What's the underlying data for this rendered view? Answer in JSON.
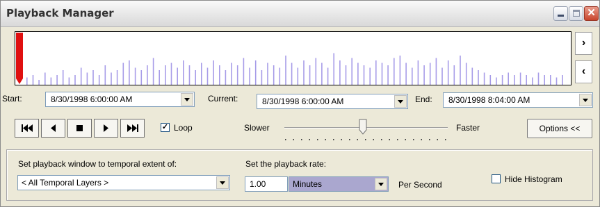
{
  "window": {
    "title": "Playback Manager"
  },
  "title_buttons": {
    "close": "✕"
  },
  "histogram": {
    "scroll_right": "›",
    "scroll_left": "‹",
    "bar_color": "#A79CE8",
    "marker_color": "#E01010",
    "relative_heights": [
      0.15,
      0.2,
      0.1,
      0.25,
      0.15,
      0.2,
      0.3,
      0.15,
      0.2,
      0.35,
      0.25,
      0.3,
      0.2,
      0.4,
      0.25,
      0.3,
      0.45,
      0.5,
      0.35,
      0.3,
      0.4,
      0.55,
      0.3,
      0.4,
      0.45,
      0.35,
      0.5,
      0.4,
      0.3,
      0.45,
      0.35,
      0.5,
      0.4,
      0.3,
      0.45,
      0.4,
      0.55,
      0.35,
      0.5,
      0.3,
      0.45,
      0.4,
      0.35,
      0.6,
      0.45,
      0.35,
      0.5,
      0.4,
      0.55,
      0.45,
      0.35,
      0.65,
      0.5,
      0.4,
      0.55,
      0.45,
      0.4,
      0.35,
      0.5,
      0.45,
      0.4,
      0.55,
      0.6,
      0.45,
      0.35,
      0.5,
      0.4,
      0.45,
      0.55,
      0.35,
      0.5,
      0.4,
      0.6,
      0.45,
      0.35,
      0.3,
      0.25,
      0.2,
      0.15,
      0.2,
      0.25,
      0.2,
      0.25,
      0.2,
      0.15,
      0.25,
      0.2,
      0.2,
      0.15,
      0.2
    ]
  },
  "time_range": {
    "start_label": "Start:",
    "start_value": "8/30/1998  6:00:00 AM",
    "current_label": "Current:",
    "current_value": "8/30/1998  6:00:00 AM",
    "end_label": "End:",
    "end_value": "8/30/1998  8:04:00 AM"
  },
  "playback": {
    "loop_label": "Loop",
    "loop_checked": true,
    "slower_label": "Slower",
    "faster_label": "Faster",
    "speed_level": 0.48,
    "options_label": "Options <<"
  },
  "options": {
    "window_label": "Set playback window to temporal extent of:",
    "window_value": "< All Temporal Layers >",
    "rate_label": "Set the playback rate:",
    "rate_value": "1.00",
    "rate_unit": "Minutes",
    "per_second_label": "Per Second",
    "hide_histogram_label": "Hide Histogram",
    "hide_histogram_checked": false
  }
}
